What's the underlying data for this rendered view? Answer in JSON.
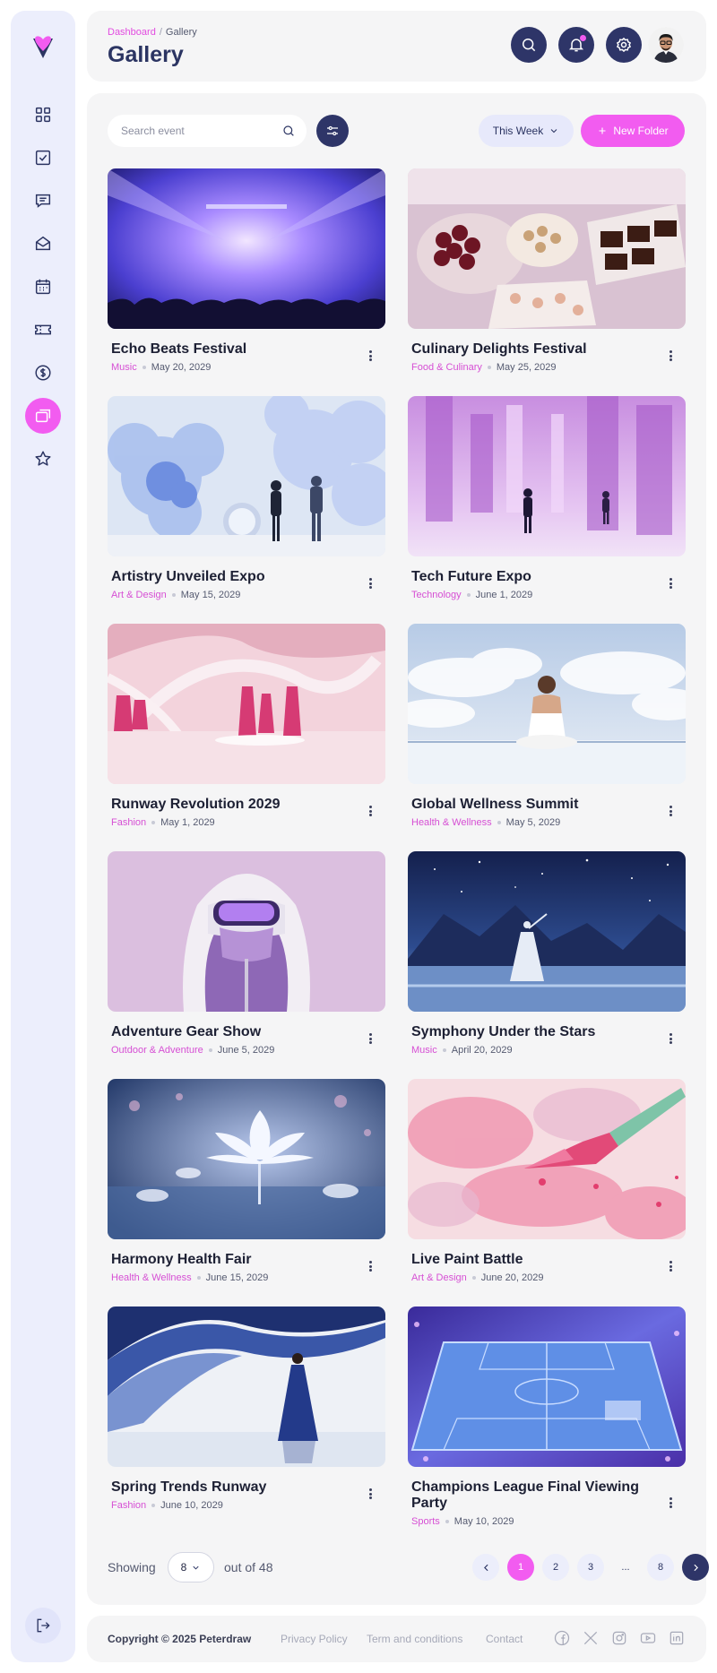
{
  "header": {
    "breadcrumb_root": "Dashboard",
    "breadcrumb_separator": "/",
    "breadcrumb_current": "Gallery",
    "title": "Gallery"
  },
  "toolbar": {
    "search_placeholder": "Search event",
    "period_label": "This Week",
    "new_folder_label": "New Folder"
  },
  "nav": [
    "dashboard",
    "tasks",
    "messages",
    "inbox",
    "calendar",
    "tickets",
    "finance",
    "gallery",
    "favorites"
  ],
  "active_nav": "gallery",
  "cards": [
    {
      "title": "Echo Beats Festival",
      "category": "Music",
      "date": "May 20, 2029"
    },
    {
      "title": "Culinary Delights Festival",
      "category": "Food & Culinary",
      "date": "May 25, 2029"
    },
    {
      "title": "Artistry Unveiled Expo",
      "category": "Art & Design",
      "date": "May 15, 2029"
    },
    {
      "title": "Tech Future Expo",
      "category": "Technology",
      "date": "June 1, 2029"
    },
    {
      "title": "Runway Revolution 2029",
      "category": "Fashion",
      "date": "May 1, 2029"
    },
    {
      "title": "Global Wellness Summit",
      "category": "Health & Wellness",
      "date": "May 5, 2029"
    },
    {
      "title": "Adventure Gear Show",
      "category": "Outdoor & Adventure",
      "date": "June 5, 2029"
    },
    {
      "title": "Symphony Under the Stars",
      "category": "Music",
      "date": "April 20, 2029"
    },
    {
      "title": "Harmony Health Fair",
      "category": "Health & Wellness",
      "date": "June 15, 2029"
    },
    {
      "title": "Live Paint Battle",
      "category": "Art & Design",
      "date": "June 20, 2029"
    },
    {
      "title": "Spring Trends Runway",
      "category": "Fashion",
      "date": "June 10, 2029"
    },
    {
      "title": "Champions League Final Viewing Party",
      "category": "Sports",
      "date": "May 10, 2029"
    }
  ],
  "pagination": {
    "showing_label": "Showing",
    "per_page": "8",
    "out_of_label": "out of 48",
    "pages": [
      "1",
      "2",
      "3",
      "...",
      "8"
    ],
    "current_page": "1"
  },
  "footer": {
    "copyright": "Copyright © 2025 Peterdraw",
    "links": [
      "Privacy Policy",
      "Term and conditions",
      "Contact"
    ],
    "social": [
      "facebook-icon",
      "x-icon",
      "instagram-icon",
      "youtube-icon",
      "linkedin-icon"
    ]
  },
  "colors": {
    "accent": "#f25cf0",
    "navy": "#2e3568",
    "sidebar_bg": "#eceefc",
    "panel_bg": "#f5f5f6"
  }
}
